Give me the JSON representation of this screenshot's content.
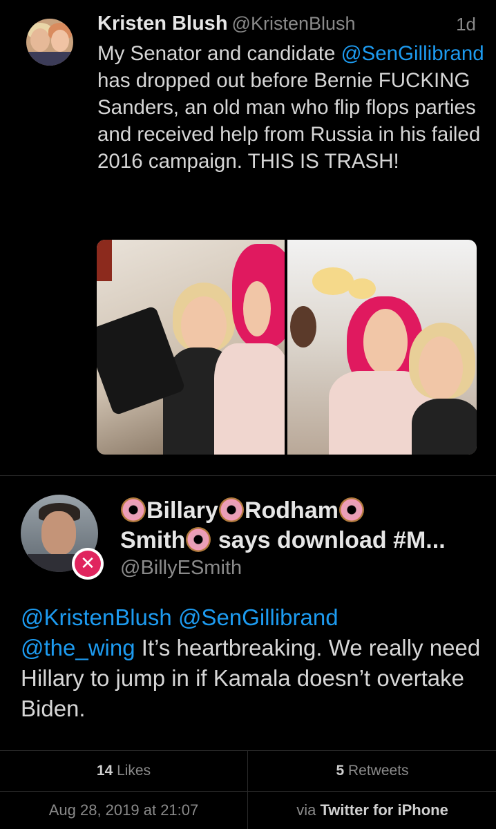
{
  "parent_tweet": {
    "author_name": "Kristen Blush",
    "author_handle": "@KristenBlush",
    "time_ago": "1d",
    "text_segments": {
      "line_start": "My Senator and candidate ",
      "mention": "@SenGillibrand",
      "rest": " has dropped out before Bernie FUCKING Sanders, an old man who flip flops parties and received help from Russia in his failed 2016 campaign. THIS IS TRASH!"
    },
    "media_count": 2
  },
  "reply_tweet": {
    "author_name_parts": [
      "Billary",
      "Rodham",
      "Smith",
      " says download #M..."
    ],
    "author_handle": "@BillyESmith",
    "mentions": [
      "@KristenBlush",
      "@SenGillibrand",
      "@the_wing"
    ],
    "text": " It’s heartbreaking. We really need Hillary to jump in if Kamala doesn’t overtake Biden.",
    "blocked_badge_icon": "blocked-x-icon"
  },
  "stats": {
    "likes_count": "14",
    "likes_label": " Likes",
    "retweets_count": "5",
    "retweets_label": " Retweets"
  },
  "meta": {
    "timestamp": "Aug 28, 2019 at 21:07",
    "via_prefix": "via ",
    "client": "Twitter for iPhone"
  },
  "colors": {
    "background": "#000000",
    "mention": "#1d9bf0",
    "muted": "#8a8a8a",
    "blocked_badge": "#e0245e"
  }
}
